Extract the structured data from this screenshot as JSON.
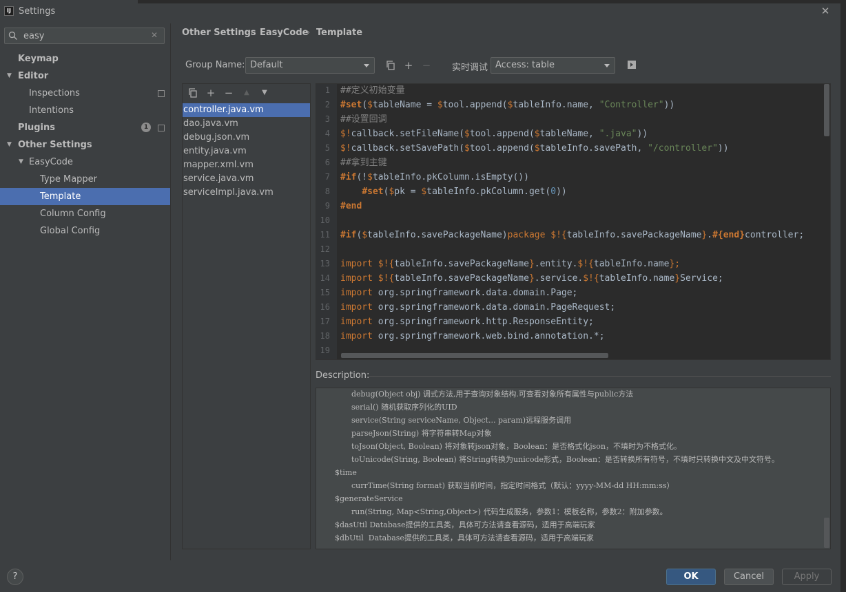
{
  "window": {
    "title": "Settings",
    "close_glyph": "✕"
  },
  "search": {
    "value": "easy",
    "clear_glyph": "✕"
  },
  "sidebar": {
    "items": [
      {
        "label": "Keymap"
      },
      {
        "label": "Editor"
      },
      {
        "label": "Inspections"
      },
      {
        "label": "Intentions"
      },
      {
        "label": "Plugins",
        "badge": "1"
      },
      {
        "label": "Other Settings"
      },
      {
        "label": "EasyCode"
      },
      {
        "label": "Type Mapper"
      },
      {
        "label": "Template"
      },
      {
        "label": "Column Config"
      },
      {
        "label": "Global Config"
      }
    ]
  },
  "breadcrumb": {
    "items": [
      "Other Settings",
      "EasyCode",
      "Template"
    ],
    "separator": "›"
  },
  "toolbar": {
    "group_label": "Group Name:",
    "group_value": "Default",
    "debug_label": "实时调试",
    "access_value": "Access: table"
  },
  "files": [
    "controller.java.vm",
    "dao.java.vm",
    "debug.json.vm",
    "entity.java.vm",
    "mapper.xml.vm",
    "service.java.vm",
    "serviceImpl.java.vm"
  ],
  "editor": {
    "line_numbers": [
      "1",
      "2",
      "3",
      "4",
      "5",
      "6",
      "7",
      "8",
      "9",
      "10",
      "11",
      "12",
      "13",
      "14",
      "15",
      "16",
      "17",
      "18",
      "19"
    ],
    "lines": [
      [
        {
          "t": "##定义初始变量",
          "c": "c-com"
        }
      ],
      [
        {
          "t": "#set",
          "c": "c-dir"
        },
        {
          "t": "(",
          "c": ""
        },
        {
          "t": "$",
          "c": "c-var"
        },
        {
          "t": "tableName = ",
          "c": ""
        },
        {
          "t": "$",
          "c": "c-var"
        },
        {
          "t": "tool.append(",
          "c": ""
        },
        {
          "t": "$",
          "c": "c-var"
        },
        {
          "t": "tableInfo.name, ",
          "c": ""
        },
        {
          "t": "\"Controller\"",
          "c": "c-str"
        },
        {
          "t": "))",
          "c": ""
        }
      ],
      [
        {
          "t": "##设置回调",
          "c": "c-com"
        }
      ],
      [
        {
          "t": "$!",
          "c": "c-var"
        },
        {
          "t": "callback.setFileName(",
          "c": ""
        },
        {
          "t": "$",
          "c": "c-var"
        },
        {
          "t": "tool.append(",
          "c": ""
        },
        {
          "t": "$",
          "c": "c-var"
        },
        {
          "t": "tableName, ",
          "c": ""
        },
        {
          "t": "\".java\"",
          "c": "c-str"
        },
        {
          "t": "))",
          "c": ""
        }
      ],
      [
        {
          "t": "$!",
          "c": "c-var"
        },
        {
          "t": "callback.setSavePath(",
          "c": ""
        },
        {
          "t": "$",
          "c": "c-var"
        },
        {
          "t": "tool.append(",
          "c": ""
        },
        {
          "t": "$",
          "c": "c-var"
        },
        {
          "t": "tableInfo.savePath, ",
          "c": ""
        },
        {
          "t": "\"/controller\"",
          "c": "c-str"
        },
        {
          "t": "))",
          "c": ""
        }
      ],
      [
        {
          "t": "##拿到主键",
          "c": "c-com"
        }
      ],
      [
        {
          "t": "#if",
          "c": "c-dir"
        },
        {
          "t": "(!",
          "c": ""
        },
        {
          "t": "$",
          "c": "c-var"
        },
        {
          "t": "tableInfo.pkColumn.isEmpty())",
          "c": ""
        }
      ],
      [
        {
          "t": "    ",
          "c": ""
        },
        {
          "t": "#set",
          "c": "c-dir"
        },
        {
          "t": "(",
          "c": ""
        },
        {
          "t": "$",
          "c": "c-var"
        },
        {
          "t": "pk = ",
          "c": ""
        },
        {
          "t": "$",
          "c": "c-var"
        },
        {
          "t": "tableInfo.pkColumn.get(",
          "c": ""
        },
        {
          "t": "0",
          "c": "c-num"
        },
        {
          "t": "))",
          "c": ""
        }
      ],
      [
        {
          "t": "#end",
          "c": "c-dir"
        }
      ],
      [],
      [
        {
          "t": "#if",
          "c": "c-dir"
        },
        {
          "t": "(",
          "c": ""
        },
        {
          "t": "$",
          "c": "c-var"
        },
        {
          "t": "tableInfo.savePackageName)",
          "c": ""
        },
        {
          "t": "package ",
          "c": "c-kw"
        },
        {
          "t": "$!{",
          "c": "c-var"
        },
        {
          "t": "tableInfo.savePackageName",
          "c": ""
        },
        {
          "t": "}",
          "c": "c-var"
        },
        {
          "t": ".",
          "c": ""
        },
        {
          "t": "#{end}",
          "c": "c-dir"
        },
        {
          "t": "controller;",
          "c": ""
        }
      ],
      [],
      [
        {
          "t": "import ",
          "c": "c-kw"
        },
        {
          "t": "$!{",
          "c": "c-var"
        },
        {
          "t": "tableInfo.savePackageName",
          "c": ""
        },
        {
          "t": "}",
          "c": "c-var"
        },
        {
          "t": ".entity.",
          "c": ""
        },
        {
          "t": "$!{",
          "c": "c-var"
        },
        {
          "t": "tableInfo.name",
          "c": ""
        },
        {
          "t": "}",
          "c": "c-var"
        },
        {
          "t": ";",
          "c": "c-kw"
        }
      ],
      [
        {
          "t": "import ",
          "c": "c-kw"
        },
        {
          "t": "$!{",
          "c": "c-var"
        },
        {
          "t": "tableInfo.savePackageName",
          "c": ""
        },
        {
          "t": "}",
          "c": "c-var"
        },
        {
          "t": ".service.",
          "c": ""
        },
        {
          "t": "$!{",
          "c": "c-var"
        },
        {
          "t": "tableInfo.name",
          "c": ""
        },
        {
          "t": "}",
          "c": "c-var"
        },
        {
          "t": "Service;",
          "c": ""
        }
      ],
      [
        {
          "t": "import ",
          "c": "c-kw"
        },
        {
          "t": "org.springframework.data.domain.Page;",
          "c": ""
        }
      ],
      [
        {
          "t": "import ",
          "c": "c-kw"
        },
        {
          "t": "org.springframework.data.domain.PageRequest;",
          "c": ""
        }
      ],
      [
        {
          "t": "import ",
          "c": "c-kw"
        },
        {
          "t": "org.springframework.http.ResponseEntity;",
          "c": ""
        }
      ],
      [
        {
          "t": "import ",
          "c": "c-kw"
        },
        {
          "t": "org.springframework.web.bind.annotation.*;",
          "c": ""
        }
      ],
      []
    ]
  },
  "description": {
    "label": "Description:",
    "lines": [
      {
        "indent": 2,
        "text": "debug(Object obj) 调式方法,用于查询对象结构.可查看对象所有属性与public方法"
      },
      {
        "indent": 2,
        "text": "serial() 随机获取序列化的UID"
      },
      {
        "indent": 2,
        "text": "service(String serviceName, Object... param)远程服务调用"
      },
      {
        "indent": 2,
        "text": "parseJson(String) 将字符串转Map对象"
      },
      {
        "indent": 2,
        "text": "toJson(Object, Boolean) 将对象转json对象，Boolean：是否格式化json，不填时为不格式化。"
      },
      {
        "indent": 2,
        "text": "toUnicode(String, Boolean) 将String转换为unicode形式，Boolean：是否转换所有符号，不填时只转换中文及中文符号。"
      },
      {
        "indent": 1,
        "text": "$time"
      },
      {
        "indent": 2,
        "text": "currTime(String format) 获取当前时间，指定时间格式（默认：yyyy-MM-dd HH:mm:ss）"
      },
      {
        "indent": 1,
        "text": "$generateService"
      },
      {
        "indent": 2,
        "text": "run(String, Map<String,Object>) 代码生成服务，参数1：模板名称，参数2：附加参数。"
      },
      {
        "indent": 1,
        "text": "$dasUtil Database提供的工具类，具体可方法请查看源码，适用于高端玩家"
      },
      {
        "indent": 1,
        "text": "$dbUtil  Database提供的工具类，具体可方法请查看源码，适用于高端玩家"
      }
    ]
  },
  "buttons": {
    "ok": "OK",
    "cancel": "Cancel",
    "apply": "Apply",
    "help": "?"
  }
}
